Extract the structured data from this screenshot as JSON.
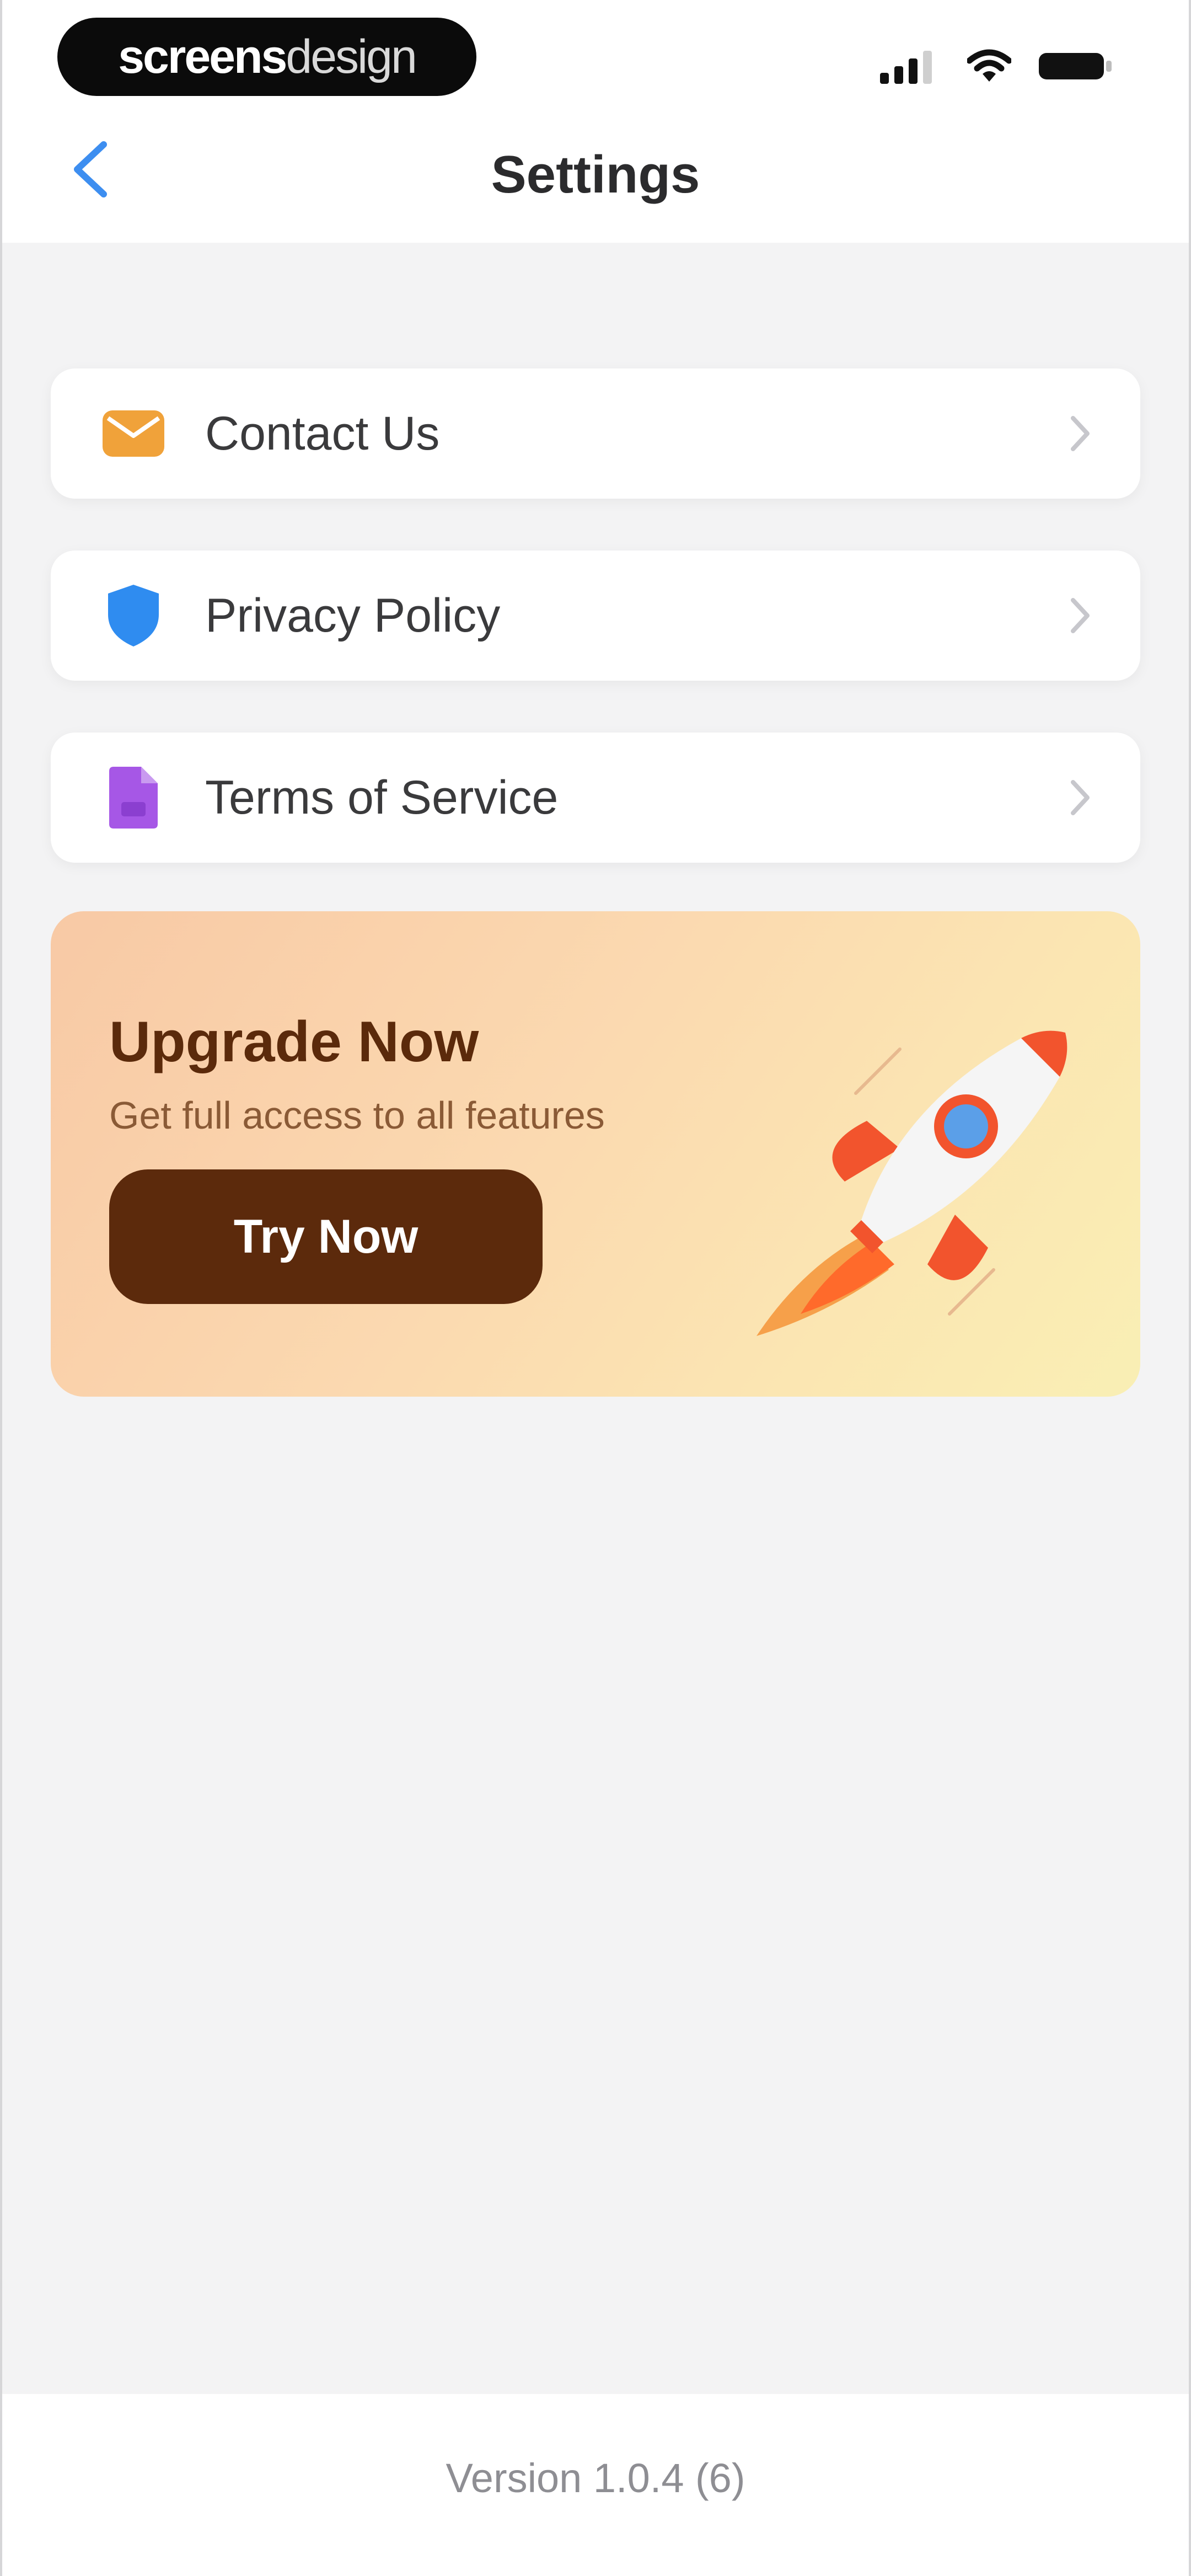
{
  "brand": {
    "bold": "screens",
    "light": "design"
  },
  "header": {
    "title": "Settings"
  },
  "menu": [
    {
      "label": "Contact Us",
      "icon": "envelope-icon",
      "color": "#f0a23a"
    },
    {
      "label": "Privacy Policy",
      "icon": "shield-icon",
      "color": "#2f8cf0"
    },
    {
      "label": "Terms of Service",
      "icon": "document-icon",
      "color": "#a657e6"
    }
  ],
  "promo": {
    "title": "Upgrade Now",
    "subtitle": "Get full access to all features",
    "button": "Try Now",
    "button_color": "#5c2a0c",
    "illustration": "rocket-illustration"
  },
  "footer": {
    "version": "Version 1.0.4 (6)"
  },
  "colors": {
    "accent": "#2f8cf0",
    "background": "#f3f3f4"
  }
}
